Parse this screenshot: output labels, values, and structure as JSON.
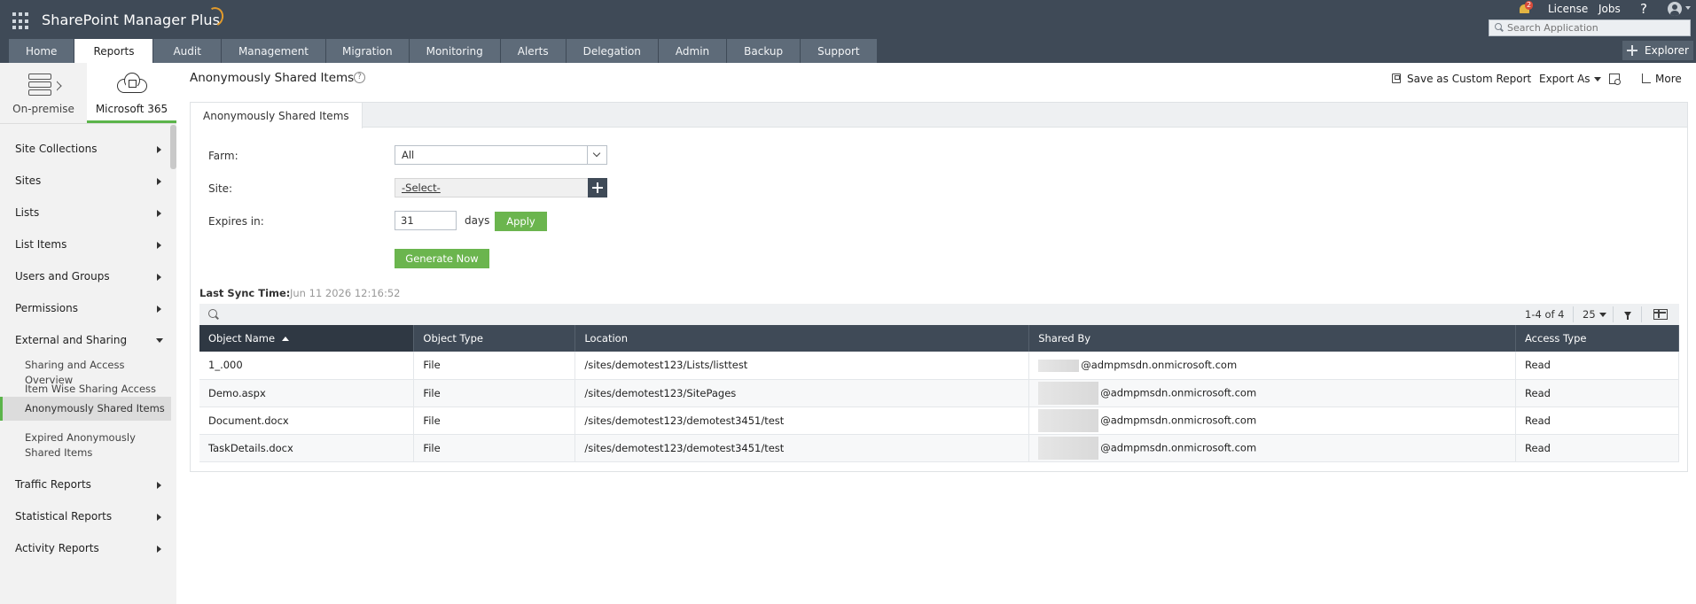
{
  "app": {
    "title": "SharePoint Manager Plus",
    "notification_count": "2",
    "license_label": "License",
    "jobs_label": "Jobs",
    "help_label": "?",
    "search_placeholder": "Search Application",
    "explorer_label": "Explorer"
  },
  "tabs": [
    {
      "label": "Home"
    },
    {
      "label": "Reports",
      "active": true
    },
    {
      "label": "Audit"
    },
    {
      "label": "Management"
    },
    {
      "label": "Migration"
    },
    {
      "label": "Monitoring"
    },
    {
      "label": "Alerts"
    },
    {
      "label": "Delegation"
    },
    {
      "label": "Admin"
    },
    {
      "label": "Backup"
    },
    {
      "label": "Support"
    }
  ],
  "sidebar": {
    "modes": [
      {
        "label": "On-premise",
        "icon": "server-export-icon"
      },
      {
        "label": "Microsoft 365",
        "icon": "cloud-icon",
        "active": true
      }
    ],
    "menu": [
      "Site Collections",
      "Sites",
      "Lists",
      "List Items",
      "Users and Groups",
      "Permissions",
      "External and Sharing",
      "Traffic Reports",
      "Statistical Reports",
      "Activity Reports"
    ],
    "sub_items": [
      "Sharing and Access Overview",
      "Item Wise Sharing Access",
      "Anonymously Shared Items",
      "Expired Anonymously Shared Items"
    ]
  },
  "page": {
    "title": "Anonymously Shared Items",
    "help": "?",
    "save_custom_report": "Save as Custom Report",
    "export_as": "Export As",
    "more": "More",
    "panel_tab": "Anonymously Shared Items"
  },
  "form": {
    "farm_label": "Farm:",
    "farm_value": "All",
    "site_label": "Site:",
    "site_value": "-Select-",
    "expires_label": "Expires in:",
    "expires_value": "31",
    "days_label": "days",
    "apply_label": "Apply",
    "generate_label": "Generate Now"
  },
  "sync": {
    "label": "Last Sync Time:",
    "value": "Jun 11 2026 12:16:52"
  },
  "table": {
    "pager": "1-4 of 4",
    "page_size": "25",
    "columns": [
      "Object Name",
      "Object Type",
      "Location",
      "Shared By",
      "Access Type"
    ],
    "rows": [
      [
        "1_.000",
        "File",
        "/sites/demotest123/Lists/listtest",
        "@admpmsdn.onmicrosoft.com",
        "Read"
      ],
      [
        "Demo.aspx",
        "File",
        "/sites/demotest123/SitePages",
        "@admpmsdn.onmicrosoft.com",
        "Read"
      ],
      [
        "Document.docx",
        "File",
        "/sites/demotest123/demotest3451/test",
        "@admpmsdn.onmicrosoft.com",
        "Read"
      ],
      [
        "TaskDetails.docx",
        "File",
        "/sites/demotest123/demotest3451/test",
        "@admpmsdn.onmicrosoft.com",
        "Read"
      ]
    ]
  }
}
